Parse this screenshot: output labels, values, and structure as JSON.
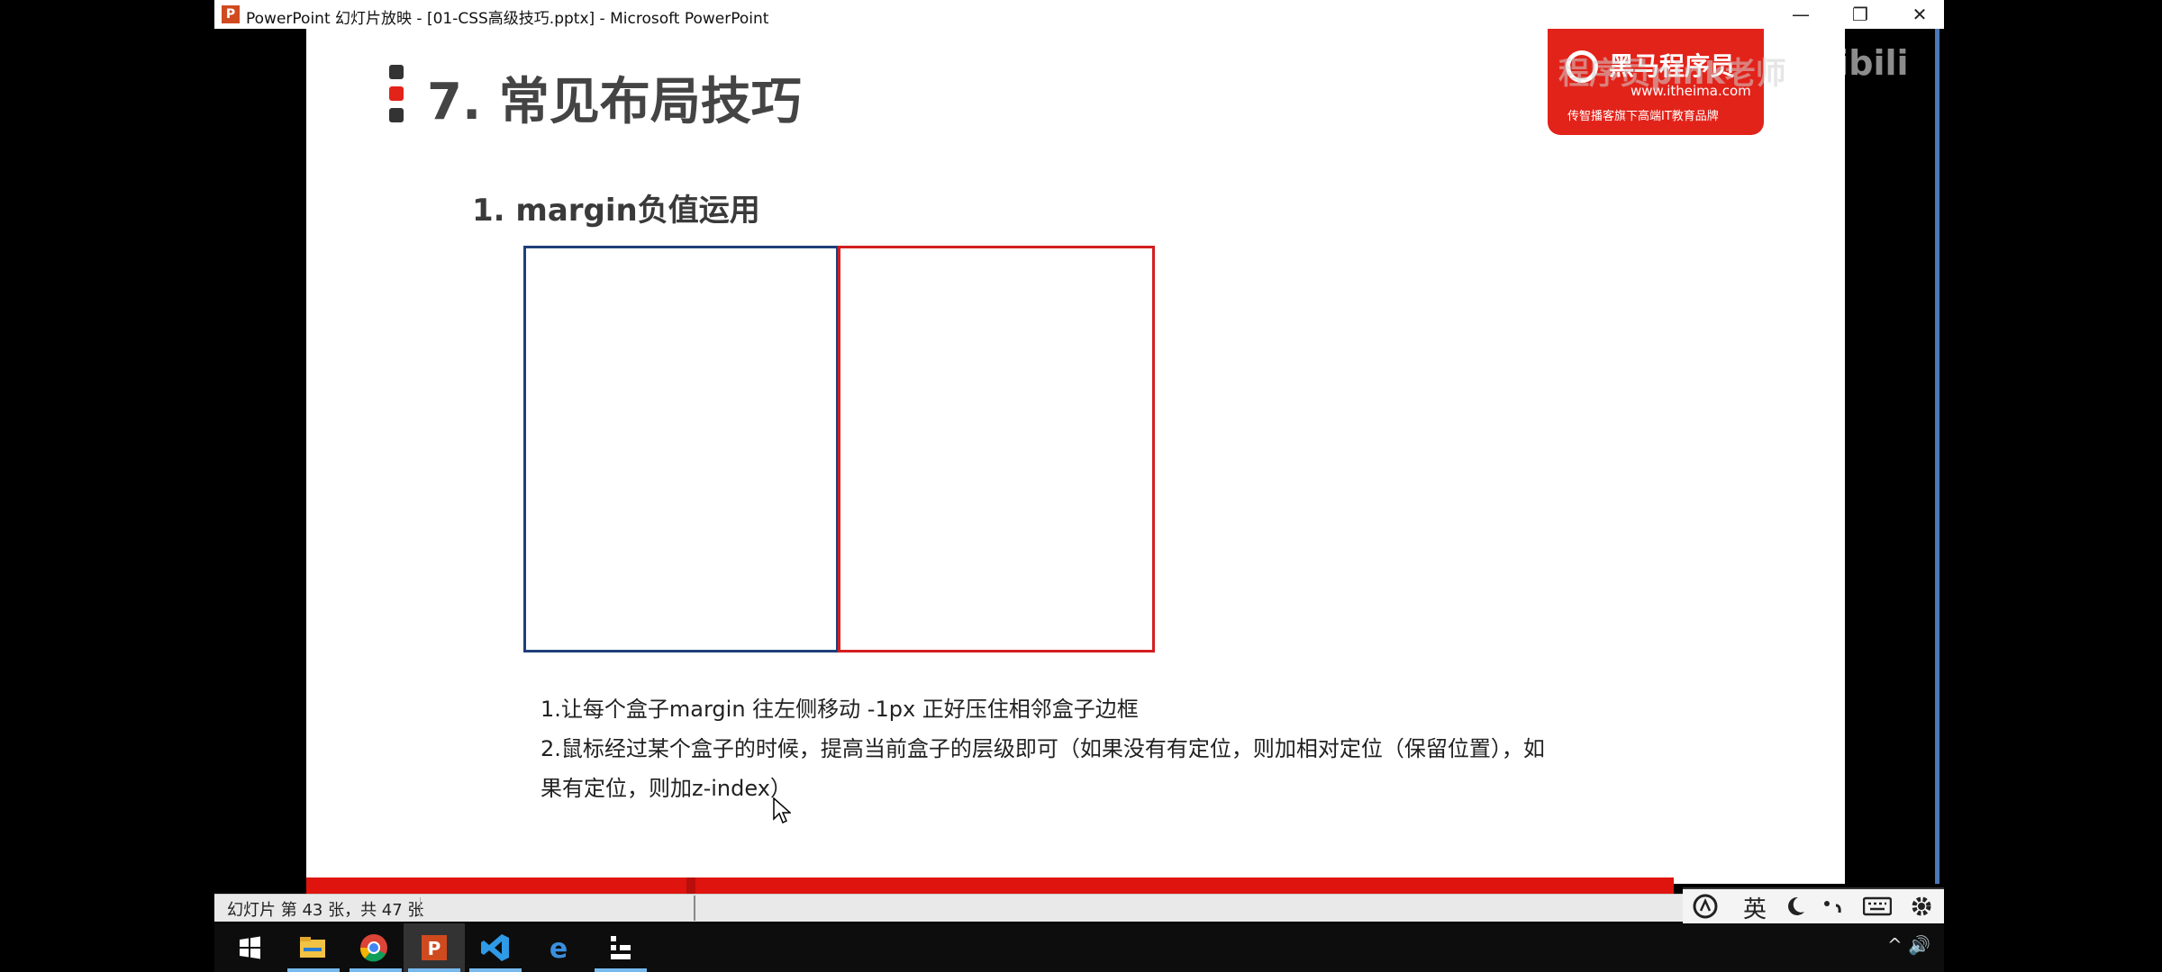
{
  "window": {
    "title": "PowerPoint 幻灯片放映 - [01-CSS高级技巧.pptx] - Microsoft PowerPoint",
    "app_icon_letter": "P",
    "minimize": "—",
    "restore": "❐",
    "close": "✕"
  },
  "slide": {
    "title": "7. 常见布局技巧",
    "subtitle": "1. margin负值运用",
    "notes": [
      "1.让每个盒子margin 往左侧移动 -1px 正好压住相邻盒子边框",
      "2.鼠标经过某个盒子的时候，提高当前盒子的层级即可（如果没有有定位，则加相对定位（保留位置），如",
      "果有定位，则加z-index）"
    ],
    "logo": {
      "name": "黑马程序员",
      "url": "www.itheima.com",
      "tagline": "传智播客旗下高端IT教育品牌"
    },
    "colors": {
      "left_box_border": "#1f3f7a",
      "right_box_border": "#d21f1f",
      "bullet_dark": "#333333",
      "bullet_red": "#e2231a",
      "footer_red": "#e0140f"
    }
  },
  "video_overlay": {
    "watermark": "bilibili",
    "caption": "程序员pink老师"
  },
  "statusbar": {
    "text": "幻灯片 第 43 张，共 47 张"
  },
  "ime": {
    "lang": "英",
    "items": [
      "input-logo-icon",
      "moon-icon",
      "punctuation-icon",
      "keyboard-icon",
      "gear-icon"
    ]
  },
  "taskbar": {
    "icons": [
      "windows-start-icon",
      "file-explorer-icon",
      "chrome-icon",
      "powerpoint-icon",
      "vscode-icon",
      "edge-icon",
      "app-icon"
    ],
    "tray": "^ 🔊"
  }
}
